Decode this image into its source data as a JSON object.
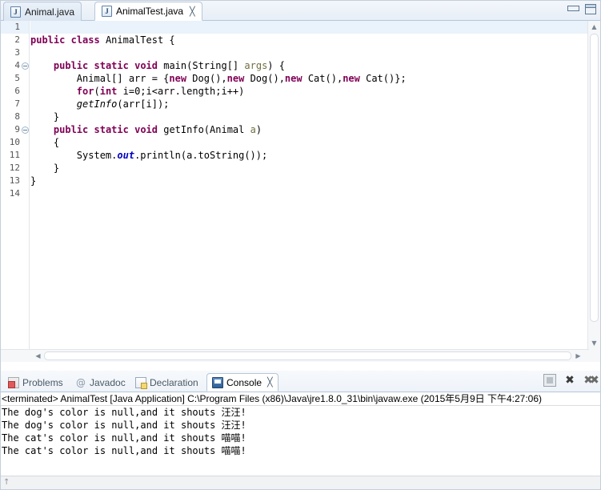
{
  "window": {
    "minimize_label": "Minimize",
    "maximize_label": "Maximize"
  },
  "editor_tabs": [
    {
      "label": "Animal.java",
      "icon": "java-file-icon",
      "active": false,
      "closable": false
    },
    {
      "label": "AnimalTest.java",
      "icon": "java-file-icon",
      "active": true,
      "closable": true,
      "close_glyph": "╳"
    }
  ],
  "editor": {
    "lines": [
      {
        "num": "1",
        "fold": false,
        "highlight": true,
        "segments": []
      },
      {
        "num": "2",
        "fold": false,
        "highlight": false,
        "segments": [
          {
            "t": "kw",
            "v": "public"
          },
          {
            "t": "p",
            "v": " "
          },
          {
            "t": "kw",
            "v": "class"
          },
          {
            "t": "p",
            "v": " AnimalTest {"
          }
        ]
      },
      {
        "num": "3",
        "fold": false,
        "highlight": false,
        "segments": []
      },
      {
        "num": "4",
        "fold": true,
        "highlight": false,
        "segments": [
          {
            "t": "p",
            "v": "    "
          },
          {
            "t": "kw",
            "v": "public"
          },
          {
            "t": "p",
            "v": " "
          },
          {
            "t": "kw",
            "v": "static"
          },
          {
            "t": "p",
            "v": " "
          },
          {
            "t": "kw",
            "v": "void"
          },
          {
            "t": "p",
            "v": " main("
          },
          {
            "t": "p",
            "v": "String[] "
          },
          {
            "t": "par",
            "v": "args"
          },
          {
            "t": "p",
            "v": ") {"
          }
        ]
      },
      {
        "num": "5",
        "fold": false,
        "highlight": false,
        "segments": [
          {
            "t": "p",
            "v": "        Animal[] arr = {"
          },
          {
            "t": "kw",
            "v": "new"
          },
          {
            "t": "p",
            "v": " Dog(),"
          },
          {
            "t": "kw",
            "v": "new"
          },
          {
            "t": "p",
            "v": " Dog(),"
          },
          {
            "t": "kw",
            "v": "new"
          },
          {
            "t": "p",
            "v": " Cat(),"
          },
          {
            "t": "kw",
            "v": "new"
          },
          {
            "t": "p",
            "v": " Cat()};"
          }
        ]
      },
      {
        "num": "6",
        "fold": false,
        "highlight": false,
        "segments": [
          {
            "t": "p",
            "v": "        "
          },
          {
            "t": "kw",
            "v": "for"
          },
          {
            "t": "p",
            "v": "("
          },
          {
            "t": "kw",
            "v": "int"
          },
          {
            "t": "p",
            "v": " i=0;i<arr."
          },
          {
            "t": "p",
            "v": "length"
          },
          {
            "t": "p",
            "v": ";i++)"
          }
        ]
      },
      {
        "num": "7",
        "fold": false,
        "highlight": false,
        "segments": [
          {
            "t": "p",
            "v": "        "
          },
          {
            "t": "it",
            "v": "getInfo"
          },
          {
            "t": "p",
            "v": "(arr[i]);"
          }
        ]
      },
      {
        "num": "8",
        "fold": false,
        "highlight": false,
        "segments": [
          {
            "t": "p",
            "v": "    }"
          }
        ]
      },
      {
        "num": "9",
        "fold": true,
        "highlight": false,
        "segments": [
          {
            "t": "p",
            "v": "    "
          },
          {
            "t": "kw",
            "v": "public"
          },
          {
            "t": "p",
            "v": " "
          },
          {
            "t": "kw",
            "v": "static"
          },
          {
            "t": "p",
            "v": " "
          },
          {
            "t": "kw",
            "v": "void"
          },
          {
            "t": "p",
            "v": " getInfo(Animal "
          },
          {
            "t": "par",
            "v": "a"
          },
          {
            "t": "p",
            "v": ")"
          }
        ]
      },
      {
        "num": "10",
        "fold": false,
        "highlight": false,
        "segments": [
          {
            "t": "p",
            "v": "    {"
          }
        ]
      },
      {
        "num": "11",
        "fold": false,
        "highlight": false,
        "segments": [
          {
            "t": "p",
            "v": "        System."
          },
          {
            "t": "fld",
            "v": "out"
          },
          {
            "t": "p",
            "v": ".println(a.toString());"
          }
        ]
      },
      {
        "num": "12",
        "fold": false,
        "highlight": false,
        "segments": [
          {
            "t": "p",
            "v": "    }"
          }
        ]
      },
      {
        "num": "13",
        "fold": false,
        "highlight": false,
        "segments": [
          {
            "t": "p",
            "v": "}"
          }
        ]
      },
      {
        "num": "14",
        "fold": false,
        "highlight": false,
        "segments": []
      }
    ],
    "scroll_up_glyph": "▲",
    "scroll_down_glyph": "▼",
    "scroll_left_glyph": "◀",
    "scroll_right_glyph": "▶"
  },
  "view_tabs": [
    {
      "label": "Problems",
      "icon": "problems-icon",
      "selected": false
    },
    {
      "label": "Javadoc",
      "icon": "javadoc-icon",
      "selected": false,
      "glyph": "@"
    },
    {
      "label": "Declaration",
      "icon": "declaration-icon",
      "selected": false
    },
    {
      "label": "Console",
      "icon": "console-icon",
      "selected": true,
      "close_glyph": "╳"
    }
  ],
  "console_toolbar": [
    {
      "name": "terminate-button",
      "label": "Terminate",
      "glyph": ""
    },
    {
      "name": "remove-launch-button",
      "label": "Remove Launch",
      "glyph": "✖"
    },
    {
      "name": "remove-all-terminated-button",
      "label": "Remove All Terminated Launches",
      "glyph": "✖✖"
    }
  ],
  "console": {
    "terminated_line": "<terminated> AnimalTest [Java Application] C:\\Program Files (x86)\\Java\\jre1.8.0_31\\bin\\javaw.exe (2015年5月9日 下午4:27:06)",
    "output_lines": [
      "The dog's color is null,and it shouts 汪汪!",
      "The dog's color is null,and it shouts 汪汪!",
      "The cat's color is null,and it shouts 喵喵!",
      "The cat's color is null,and it shouts 喵喵!"
    ]
  },
  "statusbar": {
    "caret_glyph": "↑"
  },
  "colors": {
    "keyword": "#7f0055",
    "field": "#0000c0",
    "parameter": "#6f6f3f",
    "tab_border": "#b6c7d9",
    "current_line": "#eaf2fb"
  }
}
